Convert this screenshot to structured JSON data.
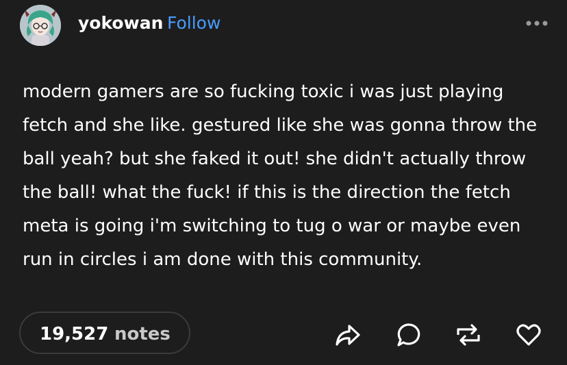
{
  "header": {
    "username": "yokowan",
    "follow_label": "Follow",
    "avatar_icon": "user-avatar-illustration",
    "more_icon": "more-options-icon"
  },
  "post": {
    "text": "modern gamers are so fucking toxic i was just playing fetch and she like. gestured like she was gonna throw the ball yeah? but she faked it out! she didn't actually throw the ball! what the fuck! if this is the direction the fetch meta is going i'm switching to tug o war or maybe even run in circles i am done with this community."
  },
  "footer": {
    "notes_count": "19,527",
    "notes_label": "notes",
    "actions": [
      "share-icon",
      "reply-icon",
      "reblog-icon",
      "like-icon"
    ]
  },
  "colors": {
    "background": "#1d1d1d",
    "text": "#ffffff",
    "accent": "#4a9bff",
    "pill_border": "#3b3b3b",
    "muted": "#c8c8c8"
  }
}
